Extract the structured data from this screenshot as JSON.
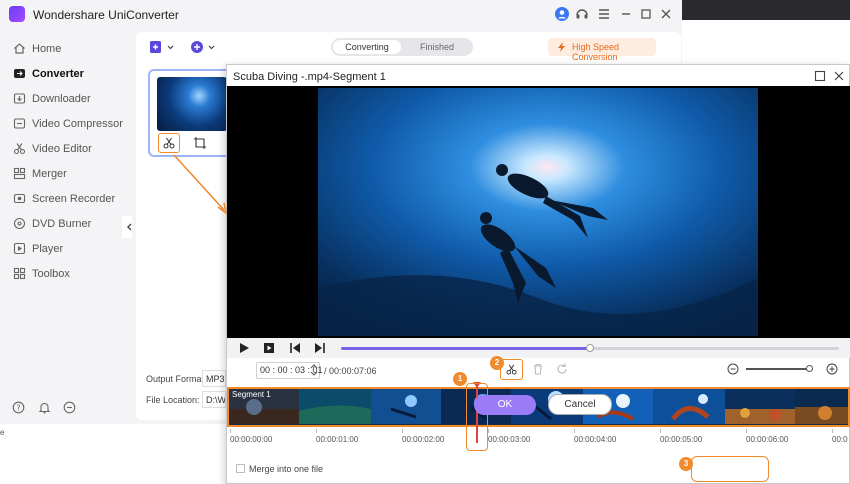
{
  "app": {
    "title": "Wondershare UniConverter",
    "accent": "#7a63e8",
    "highlight": "#f08a2c"
  },
  "sidebar": {
    "items": [
      {
        "label": "Home",
        "icon": "home-icon"
      },
      {
        "label": "Converter",
        "icon": "converter-icon",
        "active": true
      },
      {
        "label": "Downloader",
        "icon": "downloader-icon"
      },
      {
        "label": "Video Compressor",
        "icon": "compress-icon"
      },
      {
        "label": "Video Editor",
        "icon": "scissors-icon"
      },
      {
        "label": "Merger",
        "icon": "merge-icon"
      },
      {
        "label": "Screen Recorder",
        "icon": "record-icon"
      },
      {
        "label": "DVD Burner",
        "icon": "disc-icon"
      },
      {
        "label": "Player",
        "icon": "player-icon"
      },
      {
        "label": "Toolbox",
        "icon": "grid-icon"
      }
    ]
  },
  "tabs": {
    "converting": "Converting",
    "finished": "Finished"
  },
  "high_speed": "High Speed Conversion",
  "output": {
    "format_label": "Output Format:",
    "format_value": "MP3",
    "location_label": "File Location:",
    "location_value": "D:\\W"
  },
  "dialog": {
    "title": "Scuba Diving -.mp4-Segment 1",
    "time_current": "00 : 00 : 03 : 01",
    "time_total": "/ 00:00:07:06",
    "playback_progress": 0.5,
    "zoom_level": 0.98,
    "segment_label": "Segment 1",
    "ruler_labels": [
      "00:00:00:00",
      "00:00:01:00",
      "00:00:02:00",
      "00:00:03:00",
      "00:00:04:00",
      "00:00:05:00",
      "00:00:06:00",
      "00:0"
    ],
    "merge_label": "Merge into one file",
    "ok": "OK",
    "cancel": "Cancel",
    "badges": [
      "1",
      "2",
      "3"
    ]
  }
}
